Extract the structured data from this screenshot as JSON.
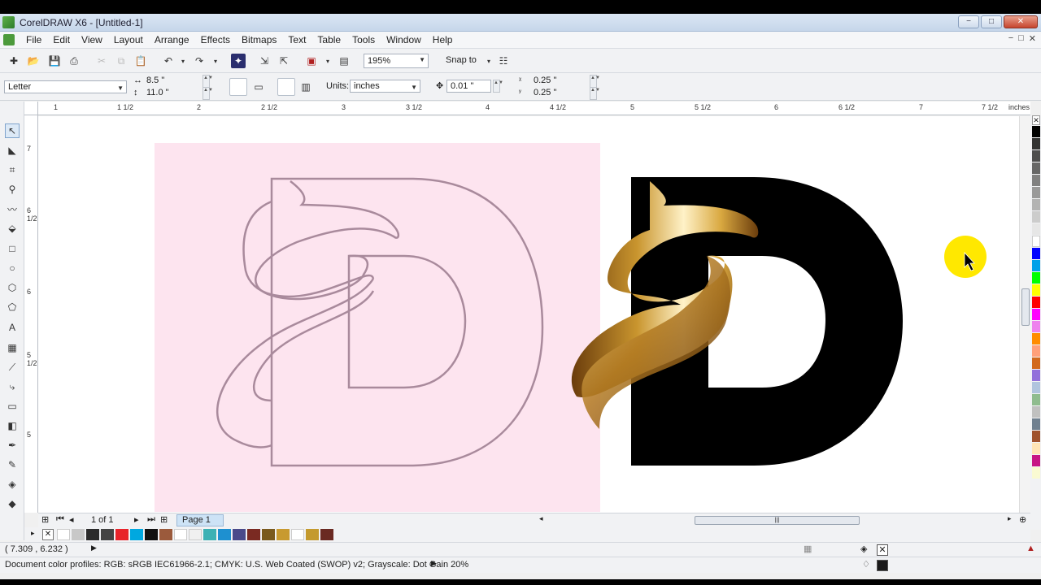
{
  "window": {
    "title": "CorelDRAW X6 - [Untitled-1]",
    "min_glyph": "−",
    "max_glyph": "□",
    "close_glyph": "✕"
  },
  "menu": {
    "items": [
      "File",
      "Edit",
      "View",
      "Layout",
      "Arrange",
      "Effects",
      "Bitmaps",
      "Text",
      "Table",
      "Tools",
      "Window",
      "Help"
    ],
    "mdi_min": "−",
    "mdi_max": "□",
    "mdi_close": "✕"
  },
  "toolbar": {
    "icons": [
      "new-document-icon",
      "open-icon",
      "save-icon",
      "print-icon",
      "cut-icon",
      "copy-icon",
      "paste-icon",
      "undo-icon",
      "redo-icon",
      "search-content-icon",
      "import-icon",
      "export-icon",
      "publish-pdf-icon",
      "app-launcher-icon",
      "welcome-screen-icon"
    ],
    "zoom_value": "195%",
    "snap_label": "Snap to"
  },
  "property_bar": {
    "paper_size": "Letter",
    "width": "8.5 \"",
    "height": "11.0 \"",
    "units_label": "Units:",
    "units_value": "inches",
    "nudge": "0.01 \"",
    "dup_x": "0.25 \"",
    "dup_y": "0.25 \""
  },
  "ruler": {
    "h_labels": [
      "1",
      "1 1/2",
      "2",
      "2 1/2",
      "3",
      "3 1/2",
      "4",
      "4 1/2",
      "5",
      "5 1/2",
      "6",
      "6 1/2",
      "7",
      "7 1/2"
    ],
    "unit": "inches",
    "v_labels": [
      "7",
      "6 1/2",
      "6",
      "5 1/2",
      "5"
    ]
  },
  "page_nav": {
    "page_count": "1 of 1",
    "tab": "Page 1"
  },
  "status": {
    "coords": "( 7.309 , 6.232 )",
    "color_profiles": "Document color profiles: RGB: sRGB IEC61966-2.1; CMYK: U.S. Web Coated (SWOP) v2; Grayscale: Dot Gain 20%"
  },
  "colors": {
    "page_bg": "#fde4ef",
    "outline": "#a98a9c",
    "logo_black": "#000000",
    "gold_dark": "#7a4a12",
    "gold_mid": "#c9952e",
    "gold_light": "#fff2c8",
    "cursor_highlight": "#ffe800"
  },
  "palette_colors": [
    "#000000",
    "#333333",
    "#4d4d4d",
    "#666666",
    "#808080",
    "#999999",
    "#b3b3b3",
    "#cccccc",
    "#e6e6e6",
    "#ffffff",
    "#0000ff",
    "#00a0e9",
    "#00ff00",
    "#ffff00",
    "#ff0000",
    "#ff00ff",
    "#ee82ee",
    "#ff8c00",
    "#ffa07a",
    "#d2691e",
    "#9370db",
    "#b0c4de",
    "#8fbc8f",
    "#c0c0c0",
    "#708090",
    "#a0522d",
    "#ffe4b5",
    "#c71585",
    "#fafad2",
    "#dda0dd"
  ],
  "doc_palette": [
    "#ffffff",
    "#c8c8c8",
    "#2b2b2b",
    "#444444",
    "#e8232a",
    "#00a8e0",
    "#111111",
    "#9b5a3c",
    "#ffffff",
    "#f0f0f0",
    "#3cb1b4",
    "#1e90d0",
    "#4a4a8a",
    "#7a2a22",
    "#7a5a1e",
    "#c89a30",
    "#ffffff",
    "#c49a2e",
    "#6a2a22"
  ]
}
